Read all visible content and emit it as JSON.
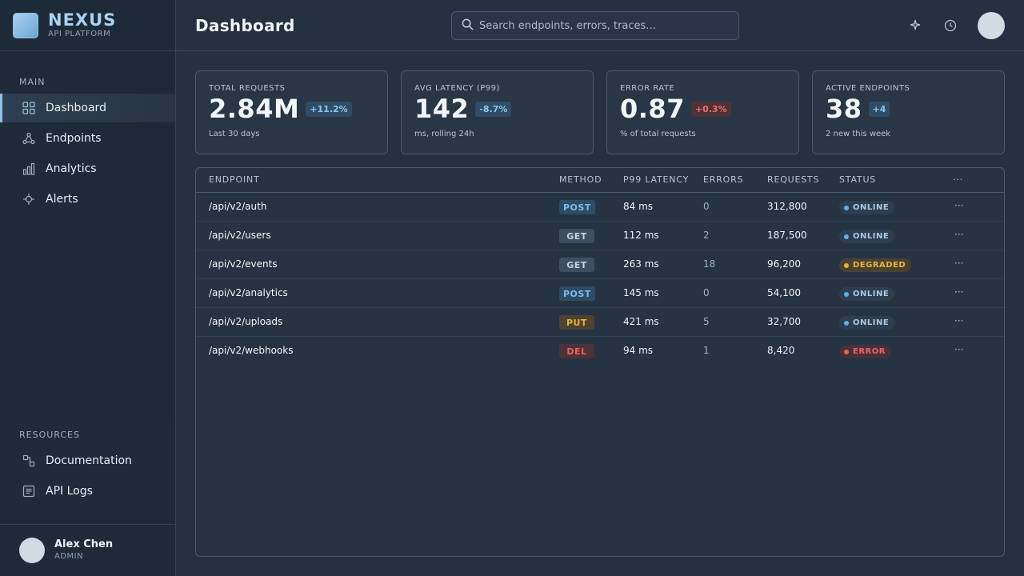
{
  "brand": {
    "name": "NEXUS",
    "subtitle": "API PLATFORM"
  },
  "sidebar": {
    "main_title": "MAIN",
    "main_items": [
      {
        "label": "Dashboard",
        "icon": "grid-icon",
        "active": true
      },
      {
        "label": "Endpoints",
        "icon": "nodes-icon"
      },
      {
        "label": "Analytics",
        "icon": "bar-chart-icon"
      },
      {
        "label": "Alerts",
        "icon": "alert-icon"
      }
    ],
    "resources_title": "RESOURCES",
    "resource_items": [
      {
        "label": "Documentation",
        "icon": "docs-icon"
      },
      {
        "label": "API Logs",
        "icon": "logs-icon"
      }
    ],
    "user": {
      "name": "Alex Chen",
      "role": "ADMIN"
    }
  },
  "header": {
    "title": "Dashboard",
    "search_placeholder": "Search endpoints, errors, traces..."
  },
  "stats": [
    {
      "label": "TOTAL REQUESTS",
      "value": "2.84M",
      "delta": "+11.2%",
      "delta_tone": "blue",
      "sub": "Last 30 days"
    },
    {
      "label": "AVG LATENCY (P99)",
      "value": "142",
      "delta": "-8.7%",
      "delta_tone": "blue",
      "sub": "ms, rolling 24h"
    },
    {
      "label": "ERROR RATE",
      "value": "0.87",
      "delta": "+0.3%",
      "delta_tone": "red",
      "sub": "% of total requests"
    },
    {
      "label": "ACTIVE ENDPOINTS",
      "value": "38",
      "delta": "+4",
      "delta_tone": "blue",
      "sub": "2 new this week"
    }
  ],
  "table": {
    "columns": [
      "ENDPOINT",
      "METHOD",
      "P99 LATENCY",
      "ERRORS",
      "REQUESTS",
      "STATUS",
      "···"
    ],
    "rows": [
      {
        "endpoint": "/api/v2/auth",
        "method": "POST",
        "latency": "84 ms",
        "errors": "0",
        "requests": "312,800",
        "status": "ONLINE"
      },
      {
        "endpoint": "/api/v2/users",
        "method": "GET",
        "latency": "112 ms",
        "errors": "2",
        "requests": "187,500",
        "status": "ONLINE"
      },
      {
        "endpoint": "/api/v2/events",
        "method": "GET",
        "latency": "263 ms",
        "errors": "18",
        "requests": "96,200",
        "status": "DEGRADED"
      },
      {
        "endpoint": "/api/v2/analytics",
        "method": "POST",
        "latency": "145 ms",
        "errors": "0",
        "requests": "54,100",
        "status": "ONLINE"
      },
      {
        "endpoint": "/api/v2/uploads",
        "method": "PUT",
        "latency": "421 ms",
        "errors": "5",
        "requests": "32,700",
        "status": "ONLINE"
      },
      {
        "endpoint": "/api/v2/webhooks",
        "method": "DEL",
        "latency": "94 ms",
        "errors": "1",
        "requests": "8,420",
        "status": "ERROR"
      }
    ],
    "row_action": "···"
  }
}
